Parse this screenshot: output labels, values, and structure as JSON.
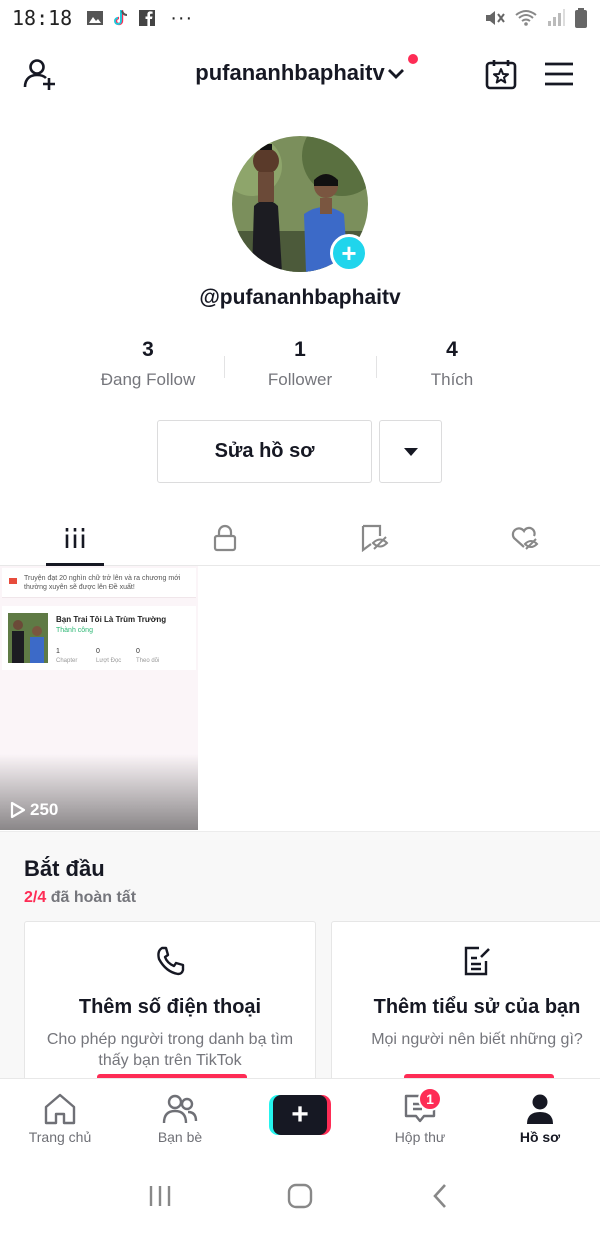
{
  "status_bar": {
    "time": "18:18",
    "dots": "···"
  },
  "header": {
    "username": "pufananhbaphaitv",
    "has_notification": true,
    "notification_color": "#fe2c55"
  },
  "profile": {
    "handle": "@pufananhbaphaitv",
    "stats": [
      {
        "value": "3",
        "label": "Đang Follow"
      },
      {
        "value": "1",
        "label": "Follower"
      },
      {
        "value": "4",
        "label": "Thích"
      }
    ],
    "edit_button": "Sửa hồ sơ"
  },
  "tabs": [
    {
      "icon": "grid-icon",
      "active": true
    },
    {
      "icon": "lock-icon",
      "active": false
    },
    {
      "icon": "bookmark-hidden-icon",
      "active": false
    },
    {
      "icon": "heart-hidden-icon",
      "active": false
    }
  ],
  "video": {
    "banner_text": "Truyện đạt 20 nghìn chữ trở lên và ra chương mới thường xuyên sẽ được lên Đề xuất!",
    "story_title": "Bạn Trai Tôi Là Trùm Trường",
    "story_status": "Thành công",
    "story_stats": [
      {
        "value": "1",
        "label": "Chapter"
      },
      {
        "value": "0",
        "label": "Lượt Đọc"
      },
      {
        "value": "0",
        "label": "Theo dõi"
      }
    ],
    "views": "250"
  },
  "getting_started": {
    "title": "Bắt đầu",
    "progress_done": "2/4",
    "progress_text": " đã hoàn tất",
    "cards": [
      {
        "icon": "phone-icon",
        "title": "Thêm số điện thoại",
        "desc": "Cho phép người trong danh bạ tìm thấy bạn trên TikTok"
      },
      {
        "icon": "edit-bio-icon",
        "title": "Thêm tiểu sử của bạn",
        "desc": "Mọi người nên biết những gì?"
      }
    ],
    "accent": "#fe2c55"
  },
  "bottom_nav": {
    "items": [
      {
        "icon": "home-icon",
        "label": "Trang chủ"
      },
      {
        "icon": "friends-icon",
        "label": "Bạn bè"
      },
      {
        "icon": "create-icon",
        "label": "+"
      },
      {
        "icon": "inbox-icon",
        "label": "Hộp thư"
      },
      {
        "icon": "profile-icon",
        "label": "Hồ sơ"
      }
    ],
    "inbox_badge": "1"
  }
}
